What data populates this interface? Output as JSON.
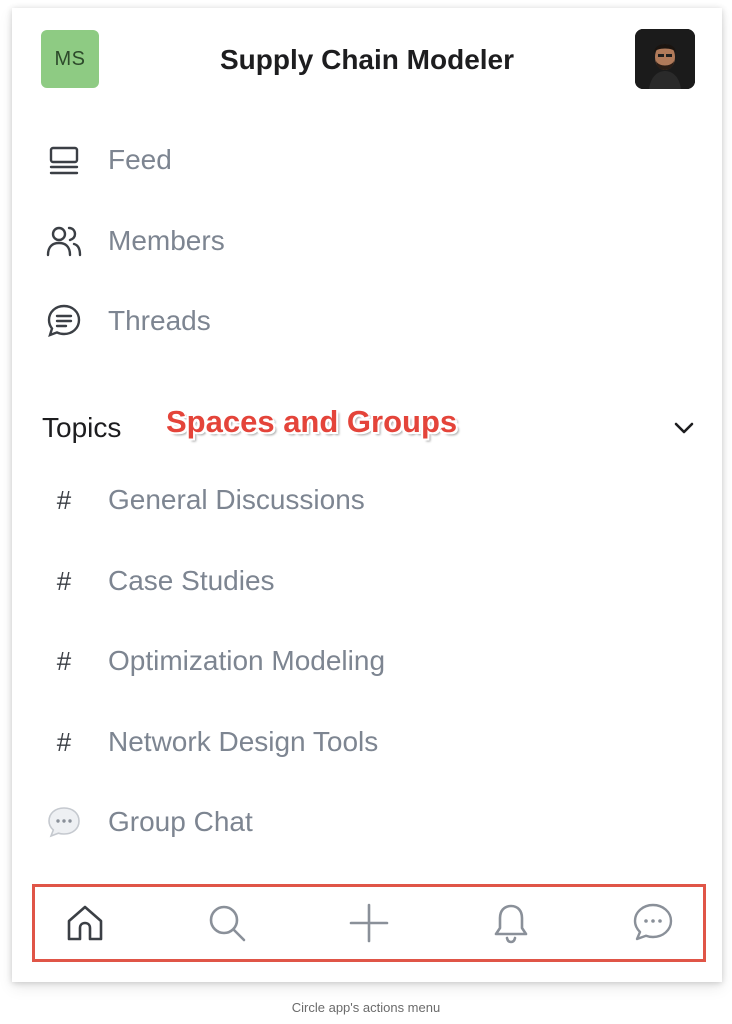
{
  "header": {
    "badge": "MS",
    "title": "Supply Chain Modeler"
  },
  "nav": [
    {
      "label": "Feed",
      "icon": "feed-icon"
    },
    {
      "label": "Members",
      "icon": "members-icon"
    },
    {
      "label": "Threads",
      "icon": "threads-icon"
    }
  ],
  "topics": {
    "label": "Topics",
    "annotation": "Spaces and Groups",
    "items": [
      {
        "label": "General Discussions",
        "icon": "hash"
      },
      {
        "label": "Case Studies",
        "icon": "hash"
      },
      {
        "label": "Optimization Modeling",
        "icon": "hash"
      },
      {
        "label": "Network Design Tools",
        "icon": "hash"
      },
      {
        "label": "Group Chat",
        "icon": "chat-bubble-icon"
      }
    ],
    "hash_symbol": "#"
  },
  "bottom_bar": {
    "tabs": [
      "home-icon",
      "search-icon",
      "plus-icon",
      "bell-icon",
      "chat-icon"
    ],
    "highlight_color": "#e05547"
  },
  "caption": "Circle app's actions menu",
  "colors": {
    "badge": "#8ecb83",
    "annotation": "#e4443a",
    "label": "#7d8591"
  }
}
